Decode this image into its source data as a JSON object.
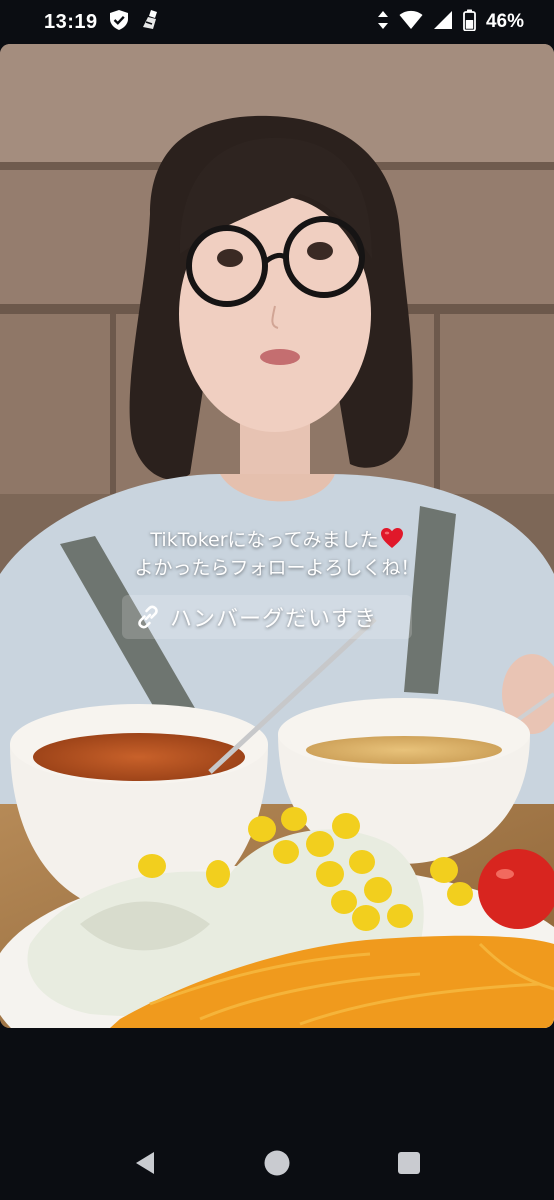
{
  "status_bar": {
    "time": "13:19",
    "battery_percent": "46%",
    "icons": [
      "shield-check-icon",
      "app-notification-icon",
      "data-arrows-icon",
      "wifi-icon",
      "cell-signal-icon",
      "battery-icon"
    ]
  },
  "video": {
    "caption_line1": "TikTokerになってみました",
    "caption_emoji": "heart-emoji",
    "caption_line2": "よかったらフォローよろしくね！",
    "link_label": "ハンバーグだいすき"
  },
  "nav_bar": {
    "buttons": [
      "back-icon",
      "home-icon",
      "recents-icon"
    ]
  },
  "colors": {
    "background": "#0b0d12",
    "heart": "#e0182a",
    "text": "#ffffff"
  }
}
